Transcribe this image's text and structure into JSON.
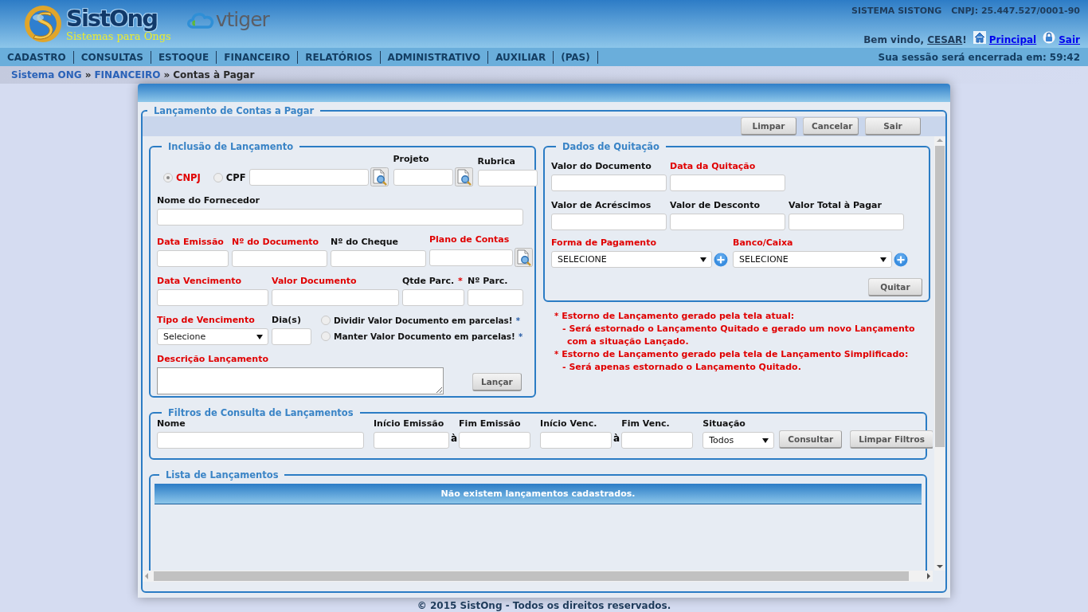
{
  "header": {
    "logo": {
      "name": "SistOng",
      "tagline": "Sistemas para Ongs"
    },
    "partner_logo": "vtiger",
    "system_name": "SISTEMA SISTONG",
    "cnpj": "CNPJ: 25.447.527/0001-90",
    "welcome": "Bem vindo, ",
    "user": "CESAR",
    "welcome_end": "!",
    "links": [
      {
        "label": "Principal",
        "kind": "home"
      },
      {
        "label": "Sair",
        "kind": "lock"
      }
    ]
  },
  "menu": {
    "items": [
      "CADASTRO",
      "CONSULTAS",
      "ESTOQUE",
      "FINANCEIRO",
      "RELATÓRIOS",
      "ADMINISTRATIVO",
      "AUXILIAR",
      "(PAS)"
    ],
    "session_label": "Sua sessão será encerrada em:",
    "session_time": "59:42"
  },
  "breadcrumb": [
    {
      "label": "Sistema ONG",
      "link": true,
      "separator": "»"
    },
    {
      "label": "FINANCEIRO",
      "link": true,
      "separator": "»"
    },
    {
      "label": "Contas à Pagar",
      "link": false
    }
  ],
  "dialog": {
    "legend": "Lançamento de Contas a Pagar",
    "toolbar": [
      "Limpar",
      "Cancelar",
      "Sair"
    ],
    "inclusion": {
      "legend": "Inclusão de Lançamento",
      "lines": [
        [
          {
            "kind": "radio",
            "label": "CNPJ",
            "selected": true,
            "required": true
          },
          {
            "kind": "radio",
            "label": "CPF",
            "selected": false,
            "required": false
          },
          {
            "kind": "lookup"
          },
          {
            "kind": "lookup",
            "label": "Projeto",
            "required": false
          },
          {
            "kind": "text",
            "label": "Rubrica",
            "required": false
          }
        ],
        [
          {
            "kind": "text",
            "label": "Nome do Fornecedor",
            "required": false
          }
        ],
        [
          {
            "kind": "text",
            "label": "Data Emissão",
            "required": true
          },
          {
            "kind": "text",
            "label": "Nº do Documento",
            "required": true
          },
          {
            "kind": "text",
            "label": "Nº do Cheque",
            "required": false
          },
          {
            "kind": "lookup",
            "label": "Plano de Contas",
            "required": true
          }
        ],
        [
          {
            "kind": "text",
            "label": "Data Vencimento",
            "required": true
          },
          {
            "kind": "text",
            "label": "Valor Documento",
            "required": true
          },
          {
            "kind": "text",
            "label": "Qtde Parc.",
            "required": false,
            "asterisk": "*"
          },
          {
            "kind": "text",
            "label": "Nº Parc.",
            "required": false
          }
        ],
        [
          {
            "kind": "select",
            "label": "Tipo de Vencimento",
            "required": true,
            "value": "Selecione"
          },
          {
            "kind": "text",
            "label": "Dia(s)",
            "required": false
          },
          {
            "kind": "radio-group",
            "options": [
              {
                "label": "Dividir Valor Documento em parcelas!",
                "asterisk": "*",
                "selected": false
              },
              {
                "label": "Manter Valor Documento em parcelas!",
                "asterisk": "*",
                "selected": false
              }
            ]
          }
        ],
        [
          {
            "kind": "textarea",
            "label": "Descrição Lançamento",
            "required": true
          },
          {
            "kind": "button",
            "label": "Lançar"
          }
        ]
      ]
    },
    "settlement": {
      "legend": "Dados de Quitação",
      "lines": [
        [
          {
            "kind": "text",
            "label": "Valor do Documento",
            "required": false
          },
          {
            "kind": "text",
            "label": "Data da Quitação",
            "required": true
          }
        ],
        [
          {
            "kind": "text",
            "label": "Valor de Acréscimos",
            "required": false
          },
          {
            "kind": "text",
            "label": "Valor de Desconto",
            "required": false
          },
          {
            "kind": "text",
            "label": "Valor Total à Pagar",
            "required": false
          }
        ],
        [
          {
            "kind": "select-add",
            "label": "Forma de Pagamento",
            "required": true,
            "value": "SELECIONE"
          },
          {
            "kind": "select-add",
            "label": "Banco/Caixa",
            "required": true,
            "value": "SELECIONE"
          }
        ]
      ],
      "button": "Quitar"
    },
    "notes": [
      {
        "kind": "heading",
        "marker": "*",
        "text": "Estorno de Lançamento gerado pela tela atual:"
      },
      {
        "kind": "item",
        "text": "- Será estornado o Lançamento Quitado e gerado um novo Lançamento com a situação Lançado."
      },
      {
        "kind": "heading",
        "marker": "*",
        "text": "Estorno de Lançamento gerado pela tela de Lançamento Simplificado:"
      },
      {
        "kind": "item",
        "text": "- Será apenas estornado o Lançamento Quitado."
      }
    ],
    "filters": {
      "legend": "Filtros de Consulta de Lançamentos",
      "items": [
        {
          "kind": "text",
          "label": "Nome",
          "required": false
        },
        {
          "kind": "text",
          "label": "Início Emissão",
          "required": false
        },
        {
          "kind": "separator",
          "text": "à"
        },
        {
          "kind": "text",
          "label": "Fim Emissão",
          "required": false
        },
        {
          "kind": "text",
          "label": "Início Venc.",
          "required": false
        },
        {
          "kind": "separator",
          "text": "à"
        },
        {
          "kind": "text",
          "label": "Fim Venc.",
          "required": false
        },
        {
          "kind": "select",
          "label": "Situação",
          "required": false,
          "value": "Todos"
        },
        {
          "kind": "button",
          "label": "Consultar"
        },
        {
          "kind": "button",
          "label": "Limpar Filtros"
        }
      ]
    },
    "list": {
      "legend": "Lista de Lançamentos",
      "empty_message": "Não existem lançamentos cadastrados."
    }
  },
  "footer": "© 2015 SistOng - Todos os direitos reservados."
}
